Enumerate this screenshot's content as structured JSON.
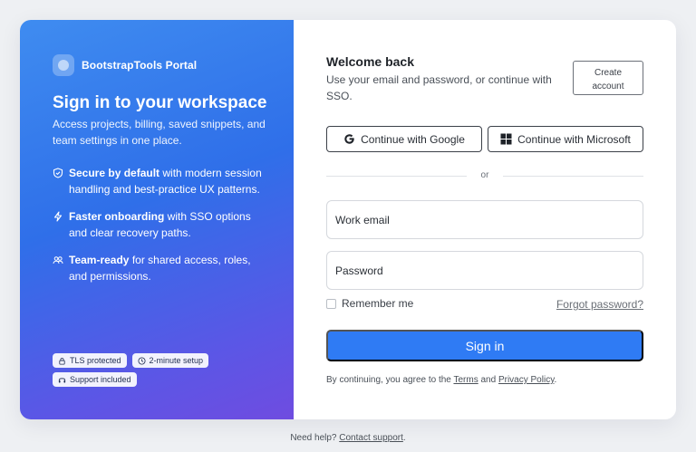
{
  "brand": {
    "name": "BootstrapTools Portal"
  },
  "left": {
    "title": "Sign in to your workspace",
    "subtitle": "Access projects, billing, saved snippets, and team settings in one place.",
    "features": [
      {
        "icon": "shield-icon",
        "bold": "Secure by default",
        "text": " with modern session handling and best-practice UX patterns."
      },
      {
        "icon": "lightning-icon",
        "bold": "Faster onboarding",
        "text": " with SSO options and clear recovery paths."
      },
      {
        "icon": "people-icon",
        "bold": "Team-ready",
        "text": " for shared access, roles, and permissions."
      }
    ],
    "badges": [
      {
        "icon": "lock-icon",
        "label": "TLS protected"
      },
      {
        "icon": "clock-icon",
        "label": "2-minute setup"
      },
      {
        "icon": "headset-icon",
        "label": "Support included"
      }
    ]
  },
  "right": {
    "title": "Welcome back",
    "subtitle": "Use your email and password, or continue with SSO.",
    "create_account": {
      "line1": "Create",
      "line2": "account"
    },
    "google_label": "Continue with Google",
    "microsoft_label": "Continue with Microsoft",
    "divider_label": "or",
    "email_label": "Work email",
    "password_label": "Password",
    "remember_label": "Remember me",
    "forgot_label": "Forgot password?",
    "signin_label": "Sign in",
    "terms": {
      "prefix": "By continuing, you agree to the ",
      "terms_link": "Terms",
      "and": " and ",
      "privacy_link": "Privacy Policy",
      "suffix": "."
    }
  },
  "footer": {
    "prefix": "Need help? ",
    "link": "Contact support",
    "suffix": "."
  },
  "colors": {
    "primary": "#2f7bf4",
    "gradient_start": "#3f8cf0",
    "gradient_end": "#6f4ce0"
  }
}
